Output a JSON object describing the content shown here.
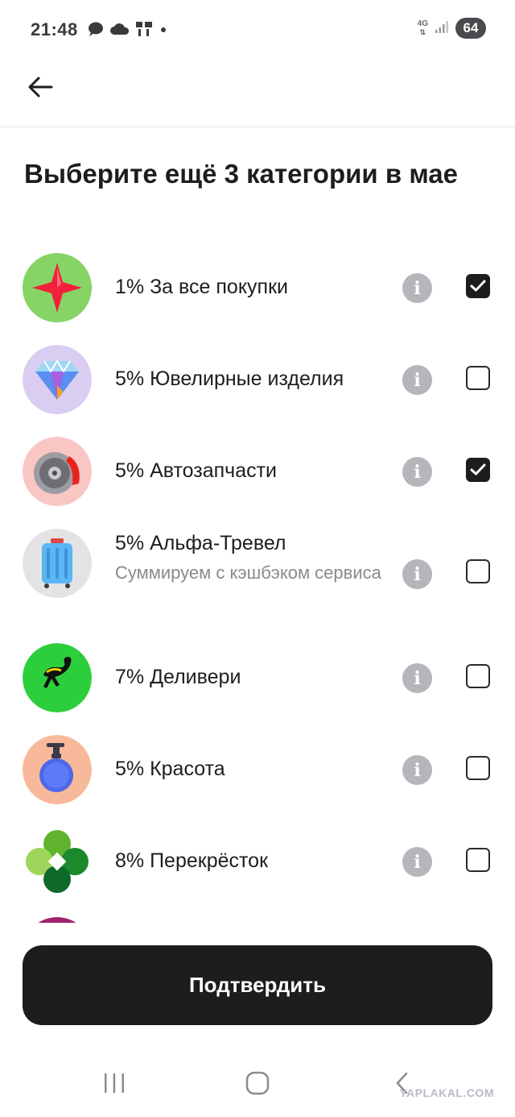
{
  "status_bar": {
    "time": "21:48",
    "left_icons": [
      "chat-icon",
      "cloud-icon",
      "yap-icon",
      "dot-icon"
    ],
    "network": "4G",
    "battery": "64"
  },
  "header": {
    "back_icon": "arrow-left-icon"
  },
  "title": "Выберите ещё 3 категории в мае",
  "categories": [
    {
      "label": "1% За все покупки",
      "icon": "red-star-icon",
      "checked": true
    },
    {
      "label": "5% Ювелирные изделия",
      "icon": "diamond-icon",
      "checked": false
    },
    {
      "label": "5% Автозапчасти",
      "icon": "brake-disc-icon",
      "checked": true
    },
    {
      "label": "5% Альфа-Тревел",
      "sub": "Суммируем с кэшбэком сервиса",
      "icon": "suitcase-icon",
      "checked": false
    },
    {
      "label": "7% Деливери",
      "icon": "ostrich-icon",
      "checked": false
    },
    {
      "label": "5% Красота",
      "icon": "soap-bottle-icon",
      "checked": false
    },
    {
      "label": "8% Перекрёсток",
      "icon": "perekrestok-logo-icon",
      "checked": false
    }
  ],
  "confirm_button": "Подтвердить",
  "nav": {
    "recent": "recent-apps-icon",
    "home": "home-icon",
    "back": "back-chevron-icon"
  },
  "watermark": "YAPLAKAL.COM",
  "colors": {
    "accent_dark": "#1d1d20",
    "info_gray": "#b5b5bb",
    "divider": "#e6e6ea"
  }
}
